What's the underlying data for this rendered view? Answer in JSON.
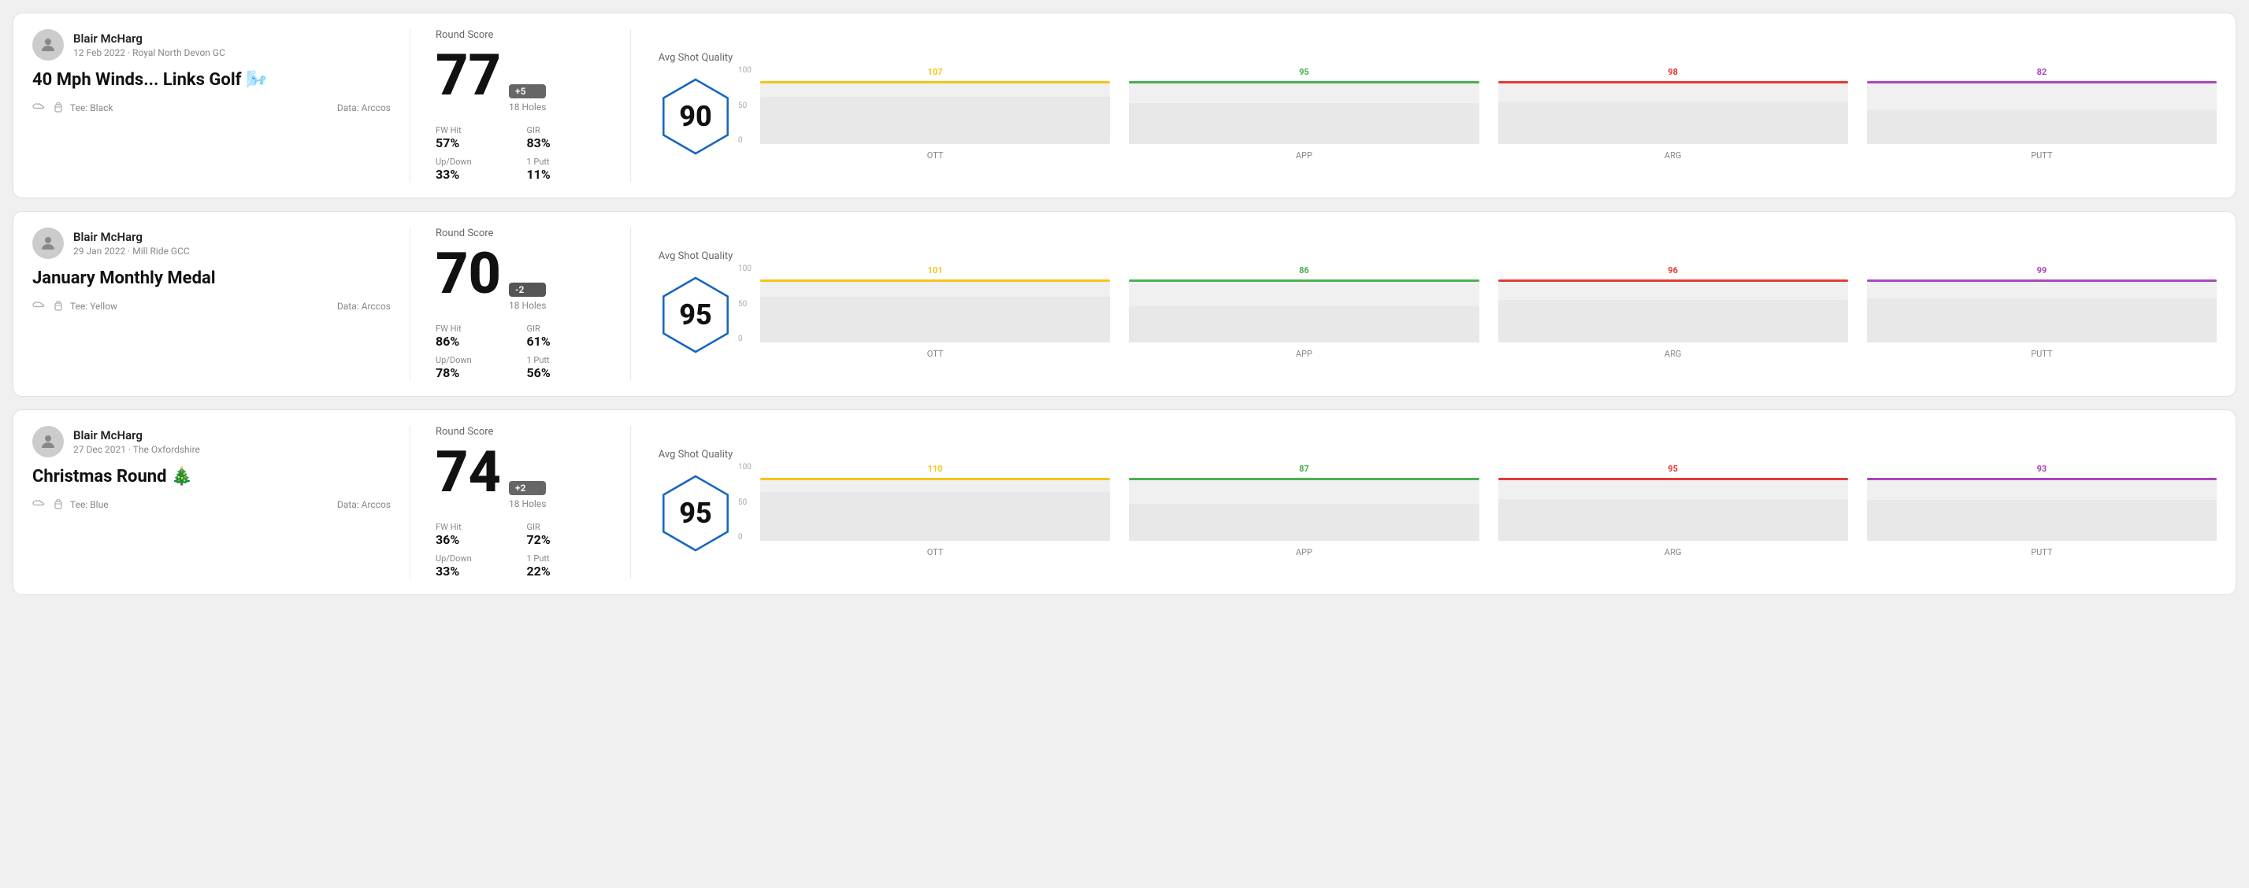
{
  "rounds": [
    {
      "user_name": "Blair McHarg",
      "date_course": "12 Feb 2022 · Royal North Devon GC",
      "title": "40 Mph Winds... Links Golf 🌬️",
      "tee": "Black",
      "data_source": "Data: Arccos",
      "round_score_label": "Round Score",
      "score": "77",
      "score_diff": "+5",
      "holes": "18 Holes",
      "fw_hit_label": "FW Hit",
      "fw_hit": "57%",
      "gir_label": "GIR",
      "gir": "83%",
      "updown_label": "Up/Down",
      "updown": "33%",
      "one_putt_label": "1 Putt",
      "one_putt": "11%",
      "avg_shot_label": "Avg Shot Quality",
      "avg_shot_score": "90",
      "chart": {
        "columns": [
          {
            "label": "OTT",
            "value": 107,
            "color": "#f5c518",
            "bar_pct": 75
          },
          {
            "label": "APP",
            "value": 95,
            "color": "#4caf50",
            "bar_pct": 65
          },
          {
            "label": "ARG",
            "value": 98,
            "color": "#e53935",
            "bar_pct": 68
          },
          {
            "label": "PUTT",
            "value": 82,
            "color": "#ab47bc",
            "bar_pct": 55
          }
        ]
      }
    },
    {
      "user_name": "Blair McHarg",
      "date_course": "29 Jan 2022 · Mill Ride GCC",
      "title": "January Monthly Medal",
      "tee": "Yellow",
      "data_source": "Data: Arccos",
      "round_score_label": "Round Score",
      "score": "70",
      "score_diff": "-2",
      "holes": "18 Holes",
      "fw_hit_label": "FW Hit",
      "fw_hit": "86%",
      "gir_label": "GIR",
      "gir": "61%",
      "updown_label": "Up/Down",
      "updown": "78%",
      "one_putt_label": "1 Putt",
      "one_putt": "56%",
      "avg_shot_label": "Avg Shot Quality",
      "avg_shot_score": "95",
      "chart": {
        "columns": [
          {
            "label": "OTT",
            "value": 101,
            "color": "#f5c518",
            "bar_pct": 72
          },
          {
            "label": "APP",
            "value": 86,
            "color": "#4caf50",
            "bar_pct": 58
          },
          {
            "label": "ARG",
            "value": 96,
            "color": "#e53935",
            "bar_pct": 67
          },
          {
            "label": "PUTT",
            "value": 99,
            "color": "#ab47bc",
            "bar_pct": 70
          }
        ]
      }
    },
    {
      "user_name": "Blair McHarg",
      "date_course": "27 Dec 2021 · The Oxfordshire",
      "title": "Christmas Round 🎄",
      "tee": "Blue",
      "data_source": "Data: Arccos",
      "round_score_label": "Round Score",
      "score": "74",
      "score_diff": "+2",
      "holes": "18 Holes",
      "fw_hit_label": "FW Hit",
      "fw_hit": "36%",
      "gir_label": "GIR",
      "gir": "72%",
      "updown_label": "Up/Down",
      "updown": "33%",
      "one_putt_label": "1 Putt",
      "one_putt": "22%",
      "avg_shot_label": "Avg Shot Quality",
      "avg_shot_score": "95",
      "chart": {
        "columns": [
          {
            "label": "OTT",
            "value": 110,
            "color": "#f5c518",
            "bar_pct": 78
          },
          {
            "label": "APP",
            "value": 87,
            "color": "#4caf50",
            "bar_pct": 59
          },
          {
            "label": "ARG",
            "value": 95,
            "color": "#e53935",
            "bar_pct": 66
          },
          {
            "label": "PUTT",
            "value": 93,
            "color": "#ab47bc",
            "bar_pct": 65
          }
        ]
      }
    }
  ]
}
